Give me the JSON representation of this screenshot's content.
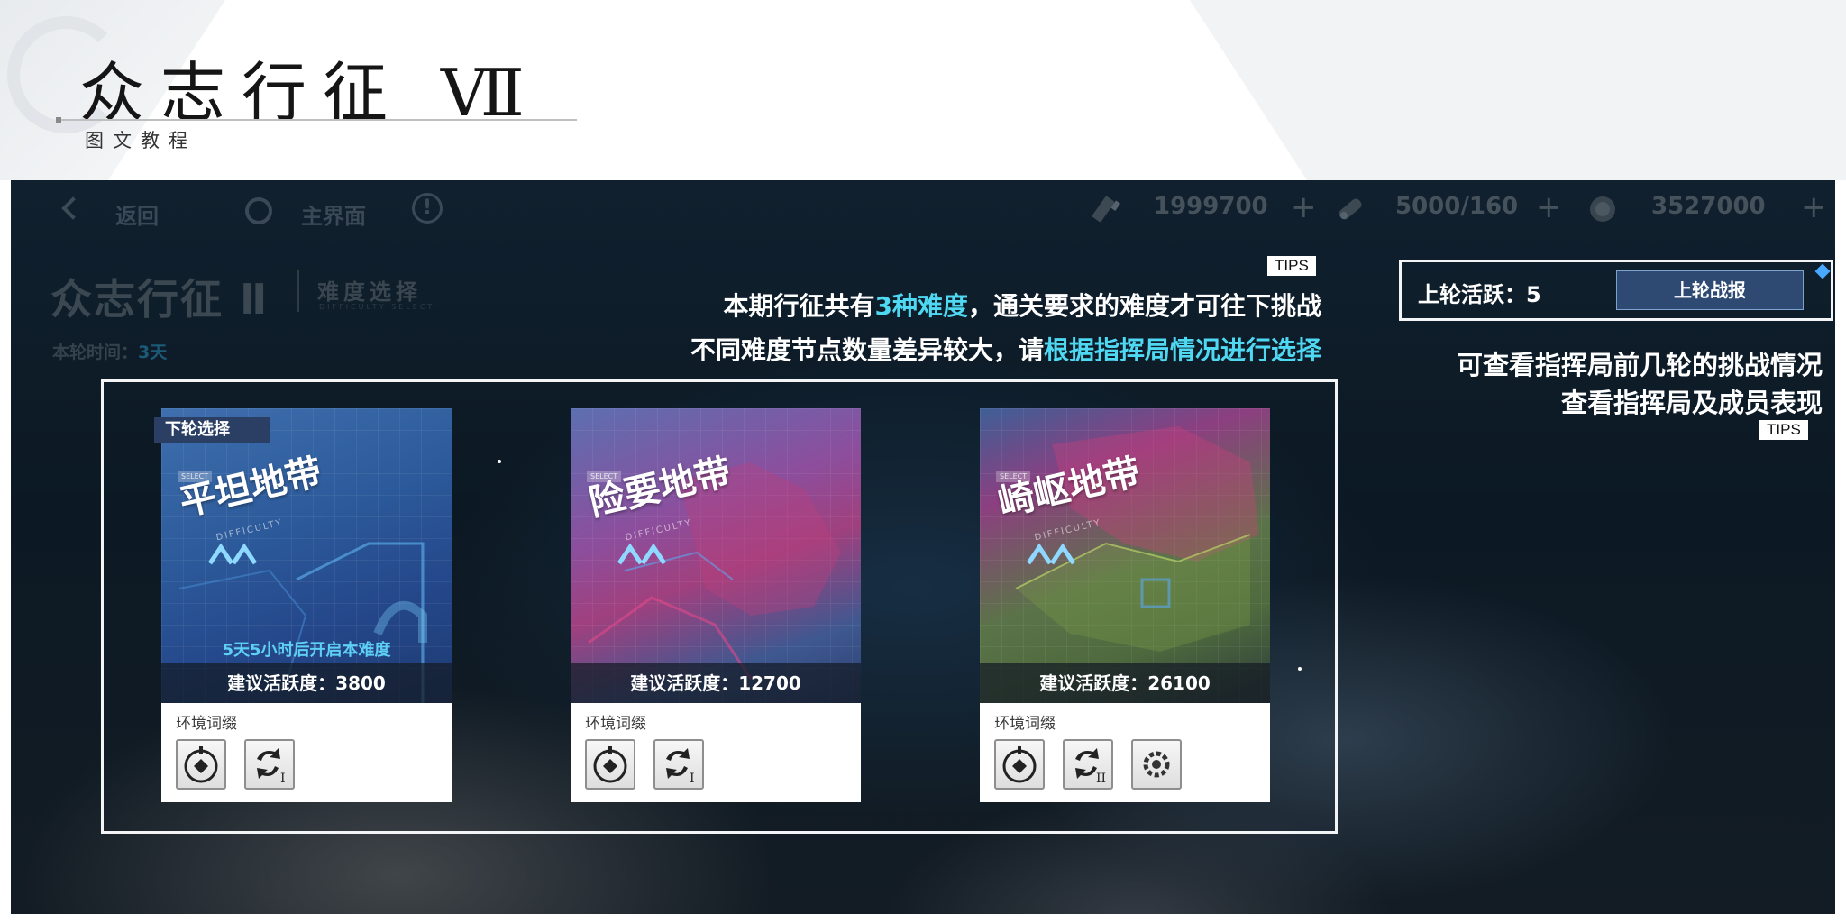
{
  "slide": {
    "title": "众志行征 Ⅶ",
    "subtitle": "图文教程"
  },
  "game": {
    "nav": {
      "back_label": "返回",
      "home_label": "主界面",
      "info_glyph": "!"
    },
    "resources": [
      {
        "icon": "fuel-icon",
        "value": "1999700",
        "plus": "+"
      },
      {
        "icon": "supply-icon",
        "value": "5000/160",
        "plus": "+"
      },
      {
        "icon": "coin-icon",
        "value": "3527000",
        "plus": "+"
      }
    ],
    "mode": {
      "title": "众志行征 Ⅱ",
      "subtitle": "难度选择",
      "subtitle_en": "DIFFICULTY SELECT",
      "round_time_label": "本轮时间：",
      "round_time_value": "3天"
    },
    "tips_left": {
      "tag": "TIPS",
      "line1_pre": "本期行征共有",
      "line1_hl": "3种难度",
      "line1_post": "，通关要求的难度才可往下挑战",
      "line2_pre": "不同难度节点数量差异较大，请",
      "line2_hl": "根据指挥局情况进行选择"
    },
    "report": {
      "last_activity_label": "上轮活跃：5",
      "button_label": "上轮战报"
    },
    "tips_right": {
      "tag": "TIPS",
      "line1": "可查看指挥局前几轮的挑战情况",
      "line2": "查看指挥局及成员表现"
    },
    "cards": [
      {
        "name": "平坦地带",
        "badge": "下轮选择",
        "small_tag": "SELECT",
        "difficulty_en": "DIFFICULTY",
        "unlock_note": "5天5小时后开启本难度",
        "suggest": "建议活跃度：3800",
        "env_label": "环境词缀",
        "env_icons": [
          "robot-head-icon",
          "recycle-level-1-icon"
        ]
      },
      {
        "name": "险要地带",
        "small_tag": "SELECT",
        "difficulty_en": "DIFFICULTY",
        "suggest": "建议活跃度：12700",
        "env_label": "环境词缀",
        "env_icons": [
          "robot-head-icon",
          "recycle-level-1-icon"
        ]
      },
      {
        "name": "崎岖地带",
        "small_tag": "SELECT",
        "difficulty_en": "DIFFICULTY",
        "suggest": "建议活跃度：26100",
        "env_label": "环境词缀",
        "env_icons": [
          "robot-head-icon",
          "recycle-level-2-icon",
          "gear-core-icon"
        ]
      }
    ],
    "colors": {
      "highlight": "#4fd8f2",
      "unlock_note": "#5fd0f5",
      "button": "#2f4a72"
    }
  }
}
